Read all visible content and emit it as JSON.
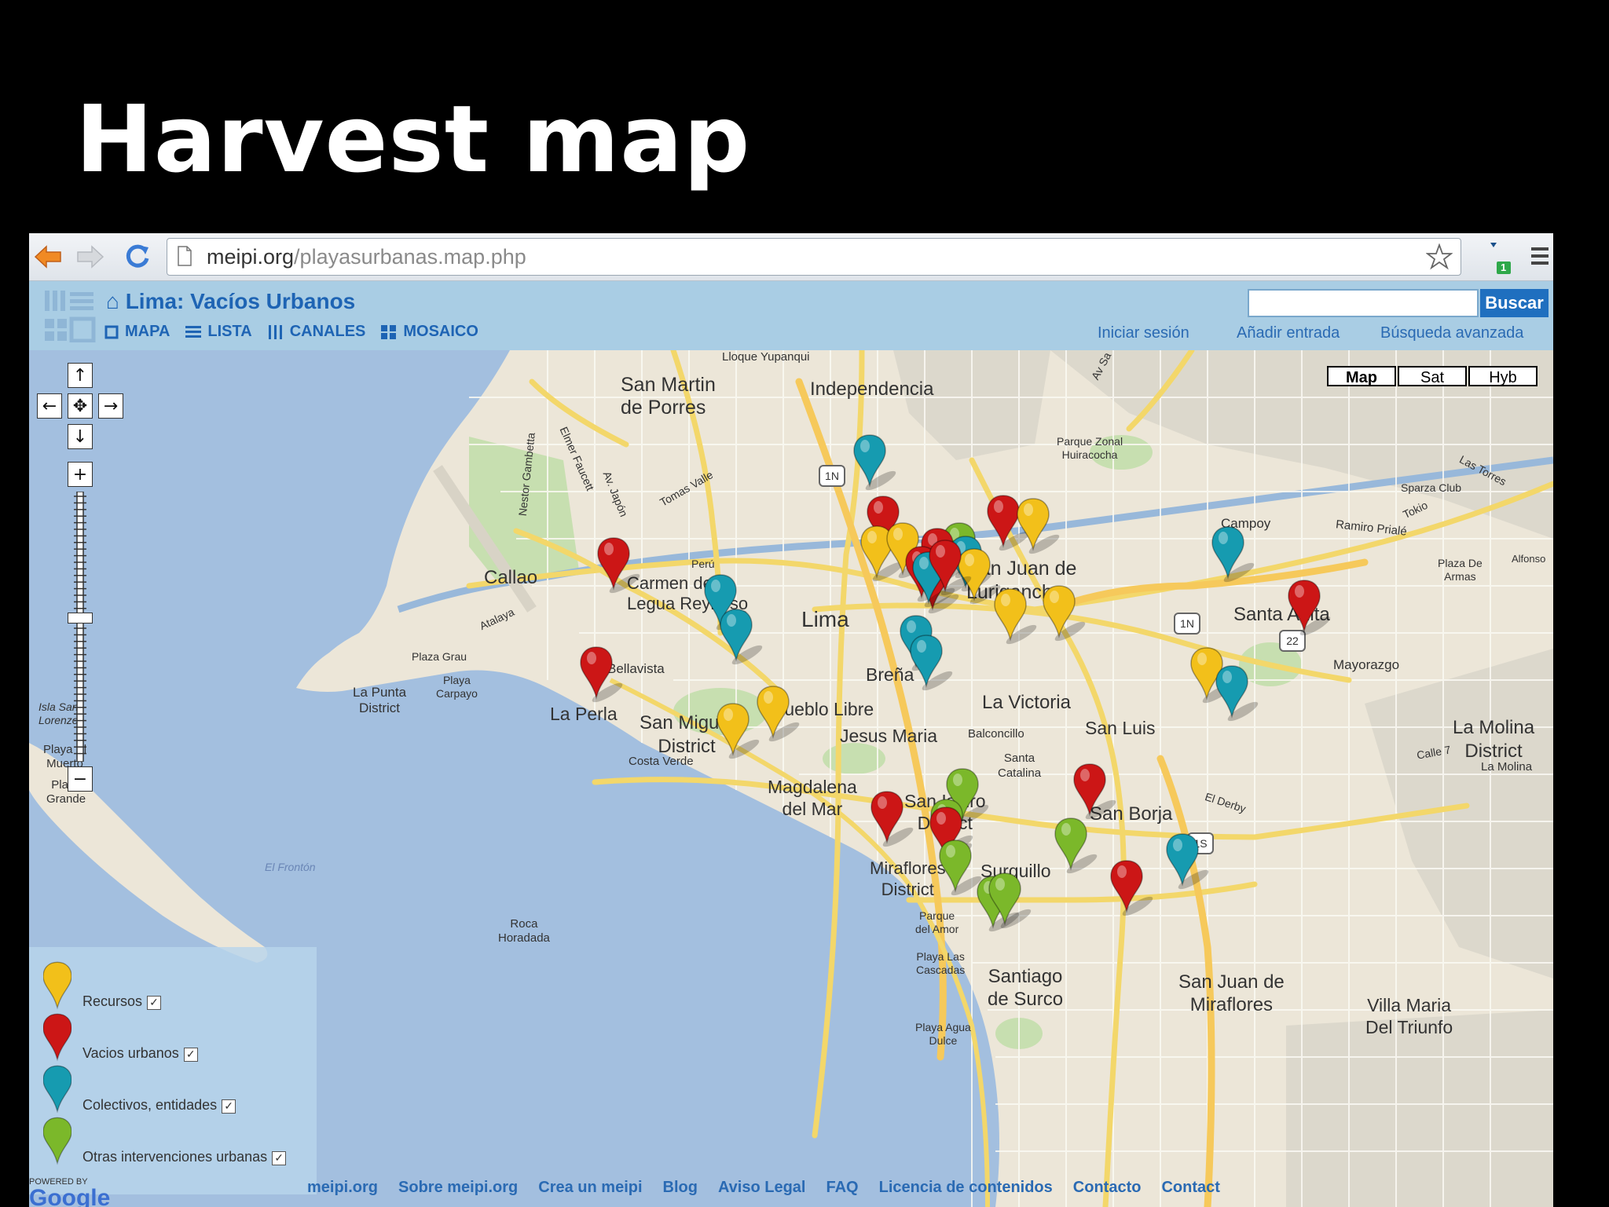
{
  "slide": {
    "title": "Harvest map"
  },
  "browser": {
    "url_domain": "meipi.org",
    "url_path": "/playasurbanas.map.php",
    "badge_count": "1"
  },
  "site": {
    "title": "Lima: Vacíos Urbanos",
    "nav": [
      "MAPA",
      "LISTA",
      "CANALES",
      "MOSAICO"
    ],
    "search_placeholder": "",
    "search_button": "Buscar",
    "links": [
      "Iniciar sesión",
      "Añadir entrada",
      "Búsqueda avanzada"
    ]
  },
  "map": {
    "types": [
      "Map",
      "Sat",
      "Hyb"
    ],
    "selected_type": "Map",
    "labels": {
      "san_martin_1": "San Martin",
      "san_martin_2": "de Porres",
      "independencia": "Independencia",
      "lloque": "Lloque Yupanqui",
      "callao": "Callao",
      "carmen_1": "Carmen de la",
      "carmen_2": "Legua Reynoso",
      "lima": "Lima",
      "bellavista": "Bellavista",
      "brena": "Breña",
      "la_perla": "La Perla",
      "san_miguel_1": "San Miguel",
      "san_miguel_2": "District",
      "pueblo_libre": "Pueblo Libre",
      "jesus_maria": "Jesus Maria",
      "la_victoria": "La Victoria",
      "san_luis": "San Luis",
      "la_molina_1": "La Molina",
      "la_molina_2": "District",
      "la_molina_small": "La Molina",
      "santa_anita": "Santa Anita",
      "mayorazgo": "Mayorazgo",
      "sjl_1": "San Juan de",
      "sjl_2": "Lurigancho",
      "magdalena_1": "Magdalena",
      "magdalena_2": "del Mar",
      "san_isidro_1": "San Isidro",
      "san_isidro_2": "District",
      "san_borja": "San Borja",
      "miraflores_1": "Miraflores",
      "miraflores_2": "District",
      "surquillo": "Surquillo",
      "surco_1": "Santiago",
      "surco_2": "de Surco",
      "sjm_1": "San Juan de",
      "sjm_2": "Miraflores",
      "vmt_1": "Villa Maria",
      "vmt_2": "Del Triunfo",
      "la_punta_1": "La Punta",
      "la_punta_2": "District",
      "costa_verde": "Costa Verde",
      "plaza_grau": "Plaza Grau",
      "playa_carpayo_1": "Playa",
      "playa_carpayo_2": "Carpayo",
      "balconcillo": "Balconcillo",
      "santa_catalina_1": "Santa",
      "santa_catalina_2": "Catalina",
      "campoy": "Campoy",
      "sparza": "Sparza Club",
      "parque_zonal_1": "Parque Zonal",
      "parque_zonal_2": "Huiracocha",
      "plaza_armas_1": "Plaza De",
      "plaza_armas_2": "Armas",
      "alfonso": "Alfonso",
      "las_torres": "Las Torres",
      "tokio": "Tokio",
      "ramiro": "Ramiro Prialé",
      "peru": "Perú",
      "atalaya": "Atalaya",
      "nestor": "Nestor Gambetta",
      "elmer": "Elmer Faucett",
      "japon": "Av. Japón",
      "tomas_valle": "Tomas Valle",
      "av_sa": "Av Sa",
      "el_derby": "El Derby",
      "calle_7": "Calle 7",
      "playa_el_muerto_1": "Playa El",
      "playa_el_muerto_2": "Muerto",
      "playa_grande_1": "Playa",
      "playa_grande_2": "Grande",
      "isla_1": "Isla San",
      "isla_2": "Lorenzo",
      "el_frontón": "El Frontón",
      "roca_1": "Roca",
      "roca_2": "Horadada",
      "parque_amor_1": "Parque",
      "parque_amor_2": "del Amor",
      "playa_cascadas_1": "Playa Las",
      "playa_cascadas_2": "Cascadas",
      "playa_agua_1": "Playa Agua",
      "playa_agua_2": "Dulce",
      "hw_1n": "1N",
      "hw_1n_2": "1N",
      "hw_22": "22",
      "hw_1s": "1S"
    },
    "marker_colors": {
      "yellow": "#f2c01a",
      "red": "#cc1616",
      "teal": "#169bb0",
      "green": "#7bb82a"
    }
  },
  "legend": [
    {
      "label": "Recursos",
      "color": "yellow",
      "checked": true
    },
    {
      "label": "Vacios urbanos",
      "color": "red",
      "checked": true
    },
    {
      "label": "Colectivos, entidades",
      "color": "teal",
      "checked": true
    },
    {
      "label": "Otras intervenciones urbanas",
      "color": "green",
      "checked": true
    }
  ],
  "footer": {
    "powered_by": "POWERED BY",
    "google": "Google",
    "links": [
      "meipi.org",
      "Sobre meipi.org",
      "Crea un meipi",
      "Blog",
      "Aviso Legal",
      "FAQ",
      "Licencia de contenidos",
      "Contacto",
      "Contact"
    ]
  }
}
